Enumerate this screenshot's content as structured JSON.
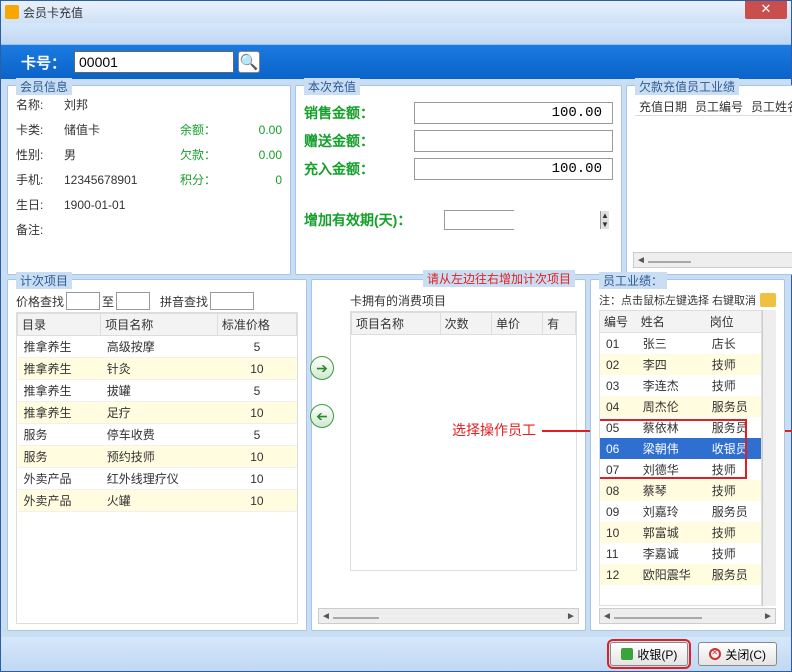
{
  "window": {
    "title": "会员卡充值"
  },
  "cardno": {
    "label": "卡号：",
    "value": "00001"
  },
  "member_info": {
    "title": "会员信息",
    "name_l": "名称:",
    "name": "刘邦",
    "type_l": "卡类:",
    "type": "储值卡",
    "sex_l": "性别:",
    "sex": "男",
    "tel_l": "手机:",
    "tel": "12345678901",
    "bday_l": "生日:",
    "bday": "1900-01-01",
    "note_l": "备注:",
    "note": "",
    "bal_l": "余额：",
    "bal": "0.00",
    "debt_l": "欠款：",
    "debt": "0.00",
    "pts_l": "积分：",
    "pts": "0"
  },
  "recharge": {
    "title": "本次充值",
    "sale_l": "销售金额：",
    "sale": "100.00",
    "gift_l": "赠送金额：",
    "gift": "",
    "in_l": "充入金额：",
    "in": "100.00",
    "valid_l": "增加有效期(天)：",
    "valid": ""
  },
  "debt_perf": {
    "title": "欠款充值员工业绩",
    "cols": [
      "充值日期",
      "员工编号",
      "员工姓名",
      ""
    ]
  },
  "jc": {
    "title": "计次项目",
    "price_l": "价格查找",
    "to": "至",
    "py_l": "拼音查找",
    "cols": [
      "目录",
      "项目名称",
      "标准价格"
    ],
    "rows": [
      [
        "推拿养生",
        "高级按摩",
        "5"
      ],
      [
        "推拿养生",
        "针灸",
        "10"
      ],
      [
        "推拿养生",
        "拔罐",
        "5"
      ],
      [
        "推拿养生",
        "足疗",
        "10"
      ],
      [
        "服务",
        "停车收费",
        "5"
      ],
      [
        "服务",
        "预约技师",
        "10"
      ],
      [
        "外卖产品",
        "红外线理疗仪",
        "10"
      ],
      [
        "外卖产品",
        "火罐",
        "10"
      ]
    ]
  },
  "mid": {
    "hint": "请从左边往右增加计次项目",
    "own_l": "卡拥有的消费项目",
    "cols": [
      "项目名称",
      "次数",
      "单价",
      "有"
    ],
    "annot": "选择操作员工"
  },
  "emp": {
    "title": "员工业绩：",
    "note": "注：点击鼠标左键选择 右键取消",
    "cols": [
      "编号",
      "姓名",
      "岗位"
    ],
    "rows": [
      [
        "01",
        "张三",
        "店长"
      ],
      [
        "02",
        "李四",
        "技师"
      ],
      [
        "03",
        "李连杰",
        "技师"
      ],
      [
        "04",
        "周杰伦",
        "服务员"
      ],
      [
        "05",
        "蔡依林",
        "服务员"
      ],
      [
        "06",
        "梁朝伟",
        "收银员"
      ],
      [
        "07",
        "刘德华",
        "技师"
      ],
      [
        "08",
        "蔡琴",
        "技师"
      ],
      [
        "09",
        "刘嘉玲",
        "服务员"
      ],
      [
        "10",
        "郭富城",
        "技师"
      ],
      [
        "11",
        "李嘉诚",
        "技师"
      ],
      [
        "12",
        "欧阳震华",
        "服务员"
      ]
    ],
    "selected": 5
  },
  "footer": {
    "cash": "收银(P)",
    "close": "关闭(C)"
  }
}
